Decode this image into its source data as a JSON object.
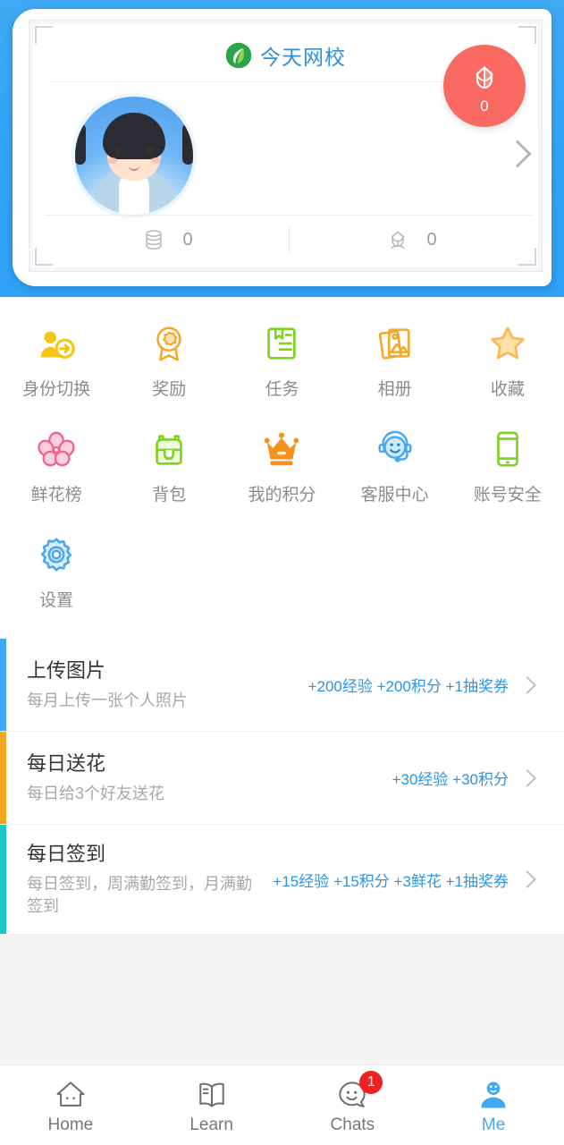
{
  "header": {
    "brand_name": "今天网校",
    "brand_logo_icon": "green-leaf-logo",
    "avatar_icon": "user-avatar",
    "flower_badge": {
      "icon": "tulip-icon",
      "count": "0",
      "color": "#f96a62"
    },
    "next_chevron_icon": "chevron-right-icon",
    "stats": [
      {
        "icon": "coin-stack-icon",
        "value": "0"
      },
      {
        "icon": "flower-icon",
        "value": "0"
      }
    ],
    "background_color": "#3fa9f5"
  },
  "grid": {
    "items": [
      {
        "label": "身份切换",
        "icon": "identity-switch-icon",
        "color": "#f5c518"
      },
      {
        "label": "奖励",
        "icon": "award-medal-icon",
        "color": "#f5a623"
      },
      {
        "label": "任务",
        "icon": "task-notebook-icon",
        "color": "#7ed321"
      },
      {
        "label": "相册",
        "icon": "photo-album-icon",
        "color": "#f5a623"
      },
      {
        "label": "收藏",
        "icon": "star-icon",
        "color": "#f7b955"
      },
      {
        "label": "鲜花榜",
        "icon": "flower-ranking-icon",
        "color": "#f06292"
      },
      {
        "label": "背包",
        "icon": "backpack-icon",
        "color": "#7ed321"
      },
      {
        "label": "我的积分",
        "icon": "crown-icon",
        "color": "#f5921e"
      },
      {
        "label": "客服中心",
        "icon": "headset-support-icon",
        "color": "#4aa8f0"
      },
      {
        "label": "账号安全",
        "icon": "phone-security-icon",
        "color": "#7ed321"
      },
      {
        "label": "设置",
        "icon": "gear-icon",
        "color": "#4aa8f0"
      }
    ]
  },
  "tasks": {
    "items": [
      {
        "title": "上传图片",
        "subtitle": "每月上传一张个人照片",
        "reward": "+200经验 +200积分 +1抽奖券",
        "bar_color": "#3fa9f5",
        "chevron_icon": "chevron-right-icon"
      },
      {
        "title": "每日送花",
        "subtitle": "每日给3个好友送花",
        "reward": "+30经验 +30积分",
        "bar_color": "#f5a623",
        "chevron_icon": "chevron-right-icon"
      },
      {
        "title": "每日签到",
        "subtitle": "每日签到，周满勤签到，月满勤签到",
        "reward": "+15经验 +15积分 +3鲜花 +1抽奖券",
        "bar_color": "#1ec8c8",
        "chevron_icon": "chevron-right-icon"
      }
    ]
  },
  "tabbar": {
    "items": [
      {
        "label": "Home",
        "icon": "home-icon",
        "active": false,
        "badge": ""
      },
      {
        "label": "Learn",
        "icon": "book-icon",
        "active": false,
        "badge": ""
      },
      {
        "label": "Chats",
        "icon": "chat-smiley-icon",
        "active": false,
        "badge": "1"
      },
      {
        "label": "Me",
        "icon": "person-icon",
        "active": true,
        "badge": ""
      }
    ],
    "active_color": "#3fa9f5",
    "badge_color": "#ee2222"
  }
}
